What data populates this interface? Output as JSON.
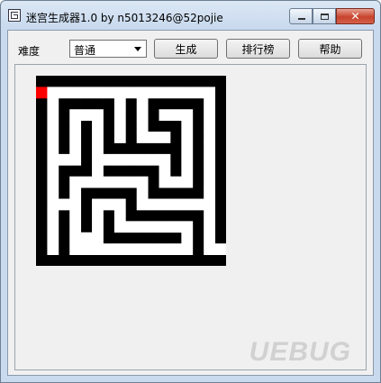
{
  "window": {
    "title": "迷宫生成器1.0 by n5013246@52pojie",
    "controls": {
      "minimize": "minimize",
      "maximize": "maximize",
      "close": "✕"
    }
  },
  "toolbar": {
    "difficulty_label": "难度",
    "difficulty_value": "普通",
    "generate_label": "生成",
    "ranking_label": "排行榜",
    "help_label": "帮助"
  },
  "maze": {
    "wall_color": "#000000",
    "path_color": "#ffffff",
    "player_color": "#ff0000",
    "grid": [
      "#################",
      "@...............#",
      "#.#####.#.#####.#",
      "#.#...#.#.#...#.#",
      "#.#.#.#.#.###.#.#",
      "#.#.#.#.#...#.#.#",
      "#.#.#.#######.#.#",
      "#...#.......#.#.#",
      "#.###.#####.#.#.#",
      "#.#.......#...#.#",
      "#.#.#####.#####.#",
      "#...#...#.......#",
      "#.#.#.#.#######.#",
      "#.#.#.#.......#.#",
      "#.#...#######.#.#",
      "#.#...........#..",
      "#################"
    ]
  },
  "watermark": "UEBUG"
}
